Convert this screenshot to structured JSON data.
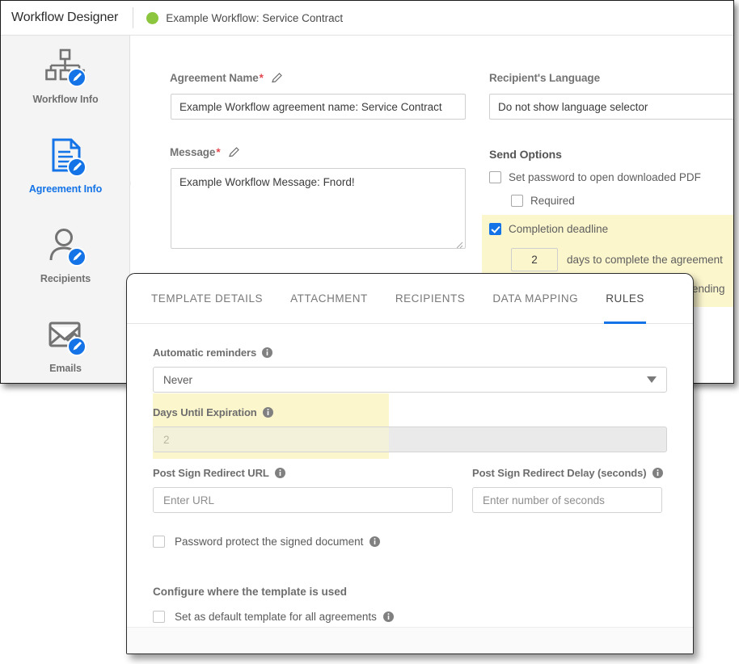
{
  "app": {
    "title": "Workflow Designer",
    "workflow_name": "Example Workflow: Service Contract",
    "status_color": "#8cc63e"
  },
  "sidebar": {
    "items": [
      {
        "label": "Workflow Info",
        "icon": "sitemap-edit-icon",
        "active": false
      },
      {
        "label": "Agreement Info",
        "icon": "document-edit-icon",
        "active": true
      },
      {
        "label": "Recipients",
        "icon": "person-edit-icon",
        "active": false
      },
      {
        "label": "Emails",
        "icon": "mail-image-edit-icon",
        "active": false
      }
    ]
  },
  "form": {
    "agreement_name": {
      "label": "Agreement Name",
      "required_marker": "*",
      "value": "Example Workflow agreement name: Service Contract"
    },
    "message": {
      "label": "Message",
      "required_marker": "*",
      "value": "Example Workflow Message: Fnord!"
    },
    "recipients_language": {
      "label": "Recipient's Language",
      "value": "Do not show language selector"
    },
    "send_options": {
      "title": "Send Options",
      "set_password": {
        "label": "Set password to open downloaded PDF",
        "checked": false
      },
      "required": {
        "label": "Required",
        "checked": false
      },
      "completion_deadline": {
        "label": "Completion deadline",
        "checked": true
      },
      "deadline_days": "2",
      "deadline_suffix": "days to complete the agreement",
      "partial_text": "ending"
    }
  },
  "dialog": {
    "tabs": [
      {
        "label": "TEMPLATE DETAILS",
        "active": false
      },
      {
        "label": "ATTACHMENT",
        "active": false
      },
      {
        "label": "RECIPIENTS",
        "active": false
      },
      {
        "label": "DATA MAPPING",
        "active": false
      },
      {
        "label": "RULES",
        "active": true
      }
    ],
    "automatic_reminders": {
      "label": "Automatic reminders",
      "value": "Never"
    },
    "days_until_expiration": {
      "label": "Days Until Expiration",
      "value": "2",
      "highlighted": true
    },
    "post_sign_redirect_url": {
      "label": "Post Sign Redirect URL",
      "placeholder": "Enter URL",
      "value": ""
    },
    "post_sign_redirect_delay": {
      "label": "Post Sign Redirect Delay (seconds)",
      "placeholder": "Enter number of seconds",
      "value": ""
    },
    "password_protect": {
      "label": "Password protect the signed document",
      "checked": false
    },
    "configure_heading": "Configure where the template is used",
    "set_default_template": {
      "label": "Set as default template for all agreements",
      "checked": false
    }
  },
  "colors": {
    "accent_blue": "#1473e6",
    "highlight_yellow": "#fcf6cd",
    "status_green": "#8cc63e",
    "required_red": "#e34850"
  }
}
